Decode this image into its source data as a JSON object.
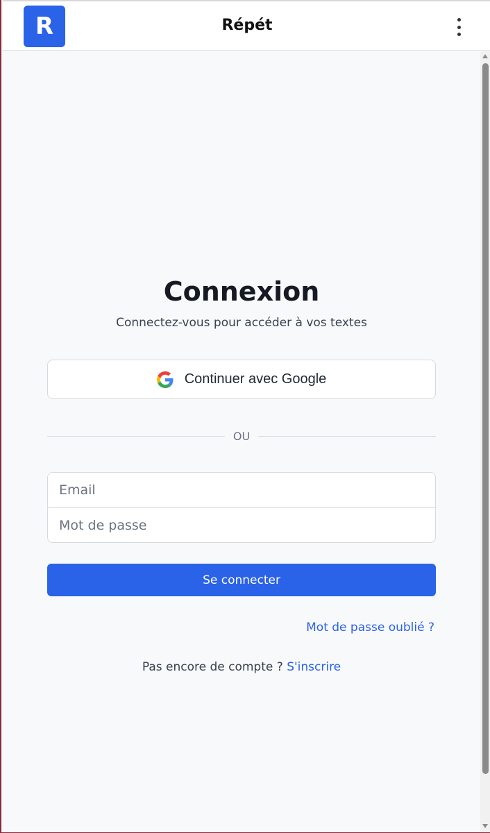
{
  "header": {
    "logo_letter": "R",
    "title": "Répét"
  },
  "login": {
    "title": "Connexion",
    "subtitle": "Connectez-vous pour accéder à vos textes",
    "google_button_label": "Continuer avec Google",
    "divider_text": "OU",
    "email_placeholder": "Email",
    "password_placeholder": "Mot de passe",
    "submit_label": "Se connecter",
    "forgot_link": "Mot de passe oublié ?",
    "signup_prompt": "Pas encore de compte ?",
    "signup_link": "S'inscrire"
  },
  "colors": {
    "accent": "#2a62e8",
    "background": "#f8f9fb"
  },
  "icons": {
    "menu": "kebab-menu-icon",
    "google": "google-icon"
  }
}
